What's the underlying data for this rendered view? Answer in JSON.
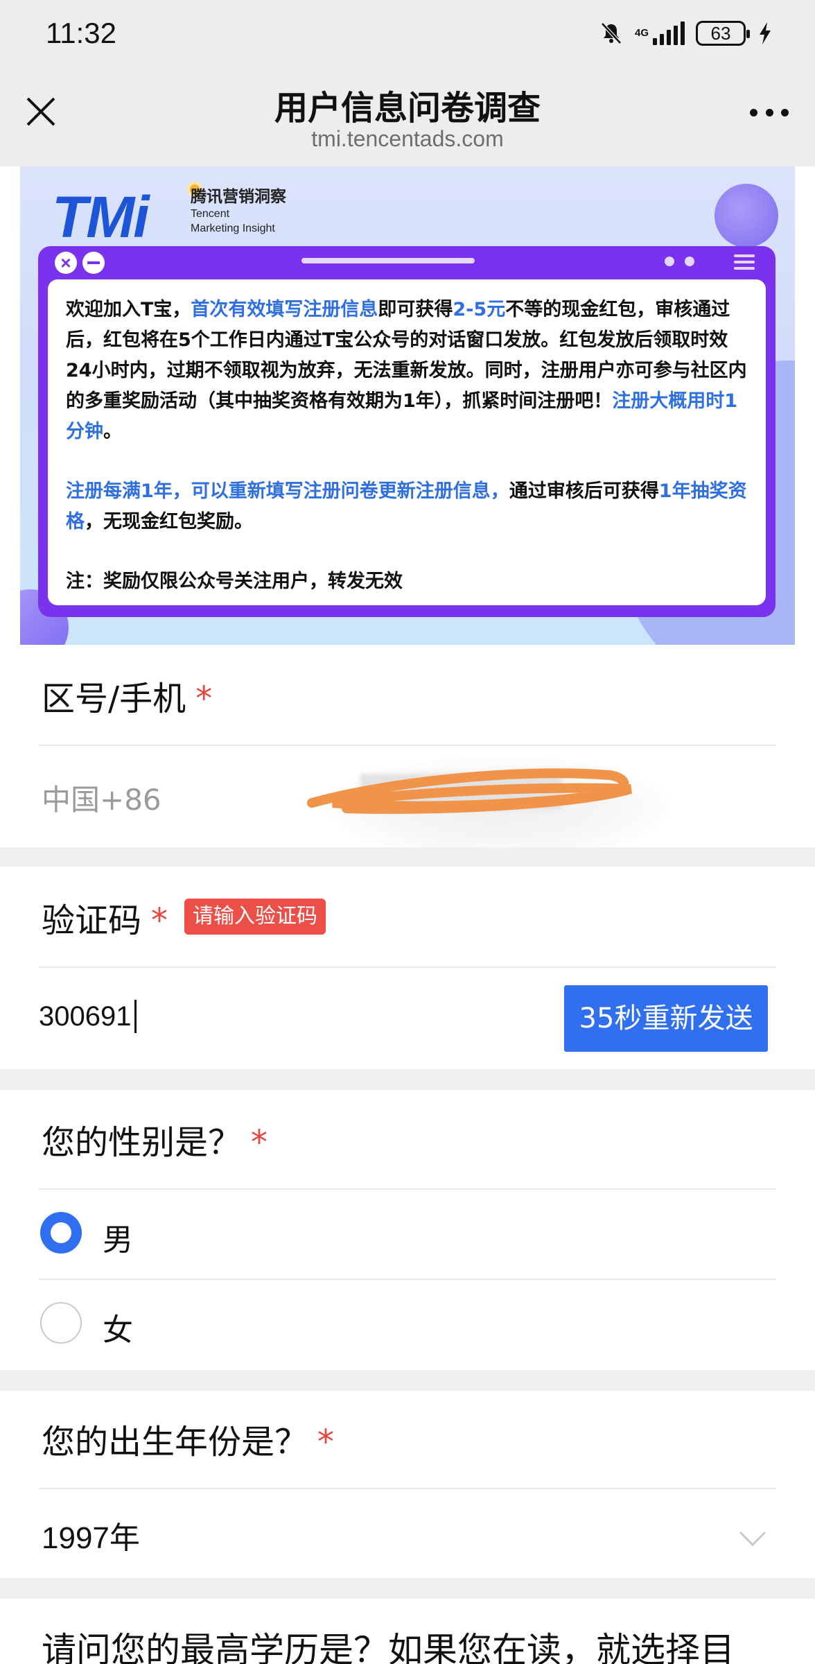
{
  "status_bar": {
    "time": "11:32",
    "network": "4G",
    "battery": "63",
    "icons": [
      "bell-muted-icon",
      "signal-icon",
      "battery-icon",
      "charging-icon"
    ]
  },
  "title_bar": {
    "title": "用户信息问卷调查",
    "domain": "tmi.tencentads.com",
    "icons": [
      "close-icon",
      "more-icon"
    ]
  },
  "banner": {
    "logo_mark": "TMi",
    "logo_cn": "腾讯营销洞察",
    "logo_en_line1": "Tencent",
    "logo_en_line2": "Marketing Insight",
    "p1": {
      "t1": "欢迎加入T宝，",
      "t2": "首次有效填写注册信息",
      "t3": "即可获得",
      "t4": "2-5元",
      "t5": "不等的现金红包，审核通过后，红包将在5个工作日内通过T宝公众号的对话窗口发放。红包发放后领取时效24小时内，过期不领取视为放弃，无法重新发放。同时，注册用户亦可参与社区内的多重奖励活动（其中抽奖资格有效期为1年），抓紧时间注册吧！",
      "t6": "注册大概用时1分钟",
      "t7": "。"
    },
    "p2": {
      "t1": "注册每满1年，可以重新填写注册问卷更新注册信息，",
      "t2": "通过审核后可获得",
      "t3": "1年抽奖资格",
      "t4": "，无现金红包奖励。"
    },
    "note": "注：奖励仅限公众号关注用户，转发无效",
    "accent_color": "#7b32ef",
    "link_color": "#2f6fe0"
  },
  "form": {
    "required_mark": "*",
    "phone": {
      "label": "区号/手机",
      "prefix": "中国+86"
    },
    "code": {
      "label": "验证码",
      "error_badge": "请输入验证码",
      "value": "300691",
      "resend_label": "35秒重新发送"
    },
    "gender": {
      "label": "您的性别是？",
      "options": [
        {
          "label": "男",
          "selected": true
        },
        {
          "label": "女",
          "selected": false
        }
      ]
    },
    "birth_year": {
      "label": "您的出生年份是？",
      "value_num": "1997",
      "value_unit": "年",
      "icon": "chevron-down-icon"
    },
    "education": {
      "label": "请问您的最高学历是？如果您在读，就选择目"
    },
    "colors": {
      "primary": "#2f6ff0",
      "required": "#e8463c",
      "error_badge_bg": "#ec4e48",
      "section_gap": "#efefef"
    }
  }
}
